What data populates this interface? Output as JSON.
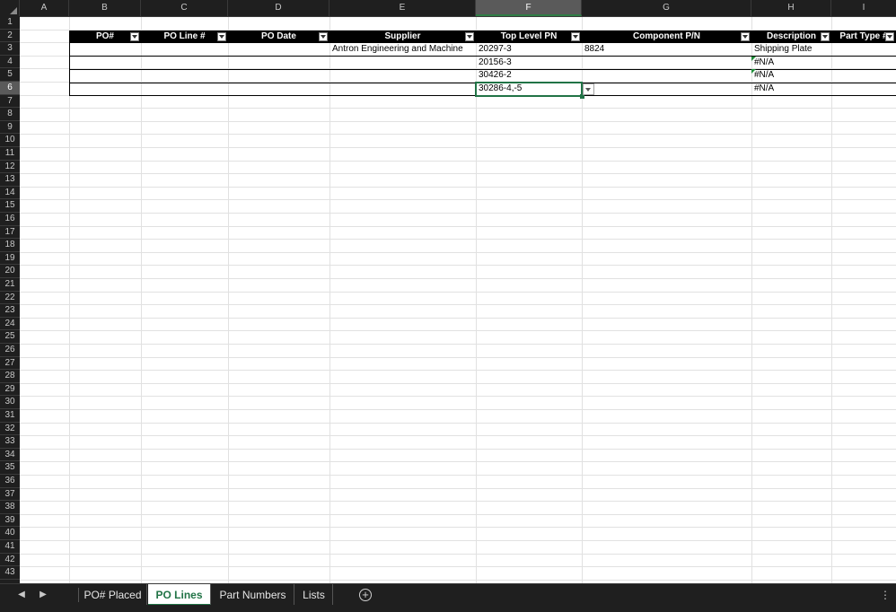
{
  "columns": [
    "A",
    "B",
    "C",
    "D",
    "E",
    "F",
    "G",
    "H",
    "I"
  ],
  "selected_column": "F",
  "rows": [
    "1",
    "2",
    "3",
    "4",
    "5",
    "6",
    "7",
    "8",
    "9",
    "10",
    "11",
    "12",
    "13",
    "14",
    "15",
    "16",
    "17",
    "18",
    "19",
    "20",
    "21",
    "22",
    "23",
    "24",
    "25",
    "26",
    "27",
    "28",
    "29",
    "30",
    "31",
    "32",
    "33",
    "34",
    "35",
    "36",
    "37",
    "38",
    "39",
    "40",
    "41",
    "42",
    "43"
  ],
  "selected_row": "6",
  "table": {
    "headers": [
      "PO#",
      "PO Line #",
      "PO Date",
      "Supplier",
      "Top Level PN",
      "Component P/N",
      "Description",
      "Part Type #"
    ],
    "rows": [
      {
        "po": "",
        "po_line": "",
        "po_date": "",
        "supplier": "Antron Engineering and Machine",
        "top_level_pn": "20297-3",
        "component_pn": "8824",
        "description": "Shipping Plate",
        "part_type": ""
      },
      {
        "po": "",
        "po_line": "",
        "po_date": "",
        "supplier": "",
        "top_level_pn": "20156-3",
        "component_pn": "",
        "description": "#N/A",
        "part_type": ""
      },
      {
        "po": "",
        "po_line": "",
        "po_date": "",
        "supplier": "",
        "top_level_pn": "30426-2",
        "component_pn": "",
        "description": "#N/A",
        "part_type": ""
      },
      {
        "po": "",
        "po_line": "",
        "po_date": "",
        "supplier": "",
        "top_level_pn": "30286-4,-5",
        "component_pn": "",
        "description": "#N/A",
        "part_type": ""
      }
    ]
  },
  "sheet_tabs": [
    "PO# Placed",
    "PO Lines",
    "Part Numbers",
    "Lists"
  ],
  "active_tab": "PO Lines",
  "colors": {
    "accent": "#217346",
    "header_bg": "#1f1f1f",
    "table_header": "#000000"
  }
}
